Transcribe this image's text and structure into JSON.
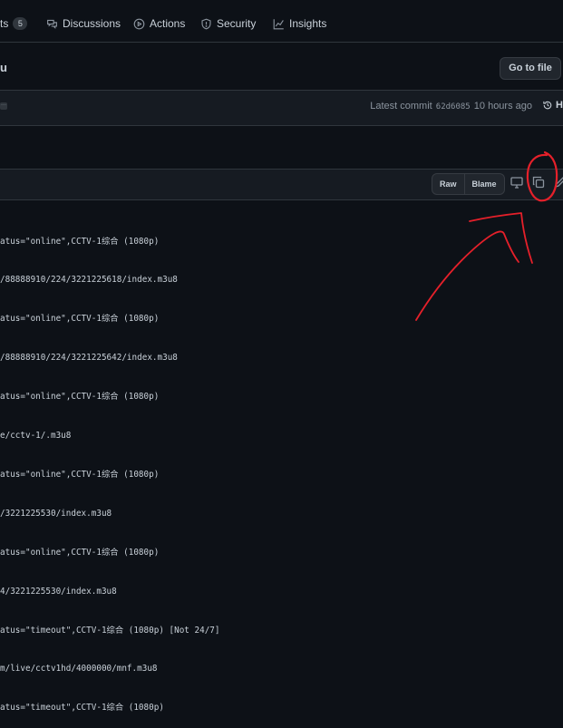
{
  "nav": {
    "pulls_fragment": "ts",
    "pulls_count": "5",
    "discussions": "Discussions",
    "actions": "Actions",
    "security": "Security",
    "insights": "Insights"
  },
  "header": {
    "title_fragment": "u",
    "goto_file": "Go to file"
  },
  "commit": {
    "prefix": "Latest commit",
    "sha": "62d6085",
    "time": "10 hours ago",
    "history_fragment": "Hi"
  },
  "file_toolbar": {
    "raw": "Raw",
    "blame": "Blame"
  },
  "code_lines": [
    "atus=\"online\",CCTV-1综合 (1080p)",
    "/88888910/224/3221225618/index.m3u8",
    "atus=\"online\",CCTV-1综合 (1080p)",
    "/88888910/224/3221225642/index.m3u8",
    "atus=\"online\",CCTV-1综合 (1080p)",
    "e/cctv-1/.m3u8",
    "atus=\"online\",CCTV-1综合 (1080p)",
    "/3221225530/index.m3u8",
    "atus=\"online\",CCTV-1综合 (1080p)",
    "4/3221225530/index.m3u8",
    "atus=\"timeout\",CCTV-1综合 (1080p) [Not 24/7]",
    "m/live/cctv1hd/4000000/mnf.m3u8",
    "atus=\"timeout\",CCTV-1综合 (1080p)"
  ],
  "colors": {
    "background": "#0d1117",
    "panel": "#161b22",
    "border": "#30363d",
    "annotation": "#e5202a"
  }
}
